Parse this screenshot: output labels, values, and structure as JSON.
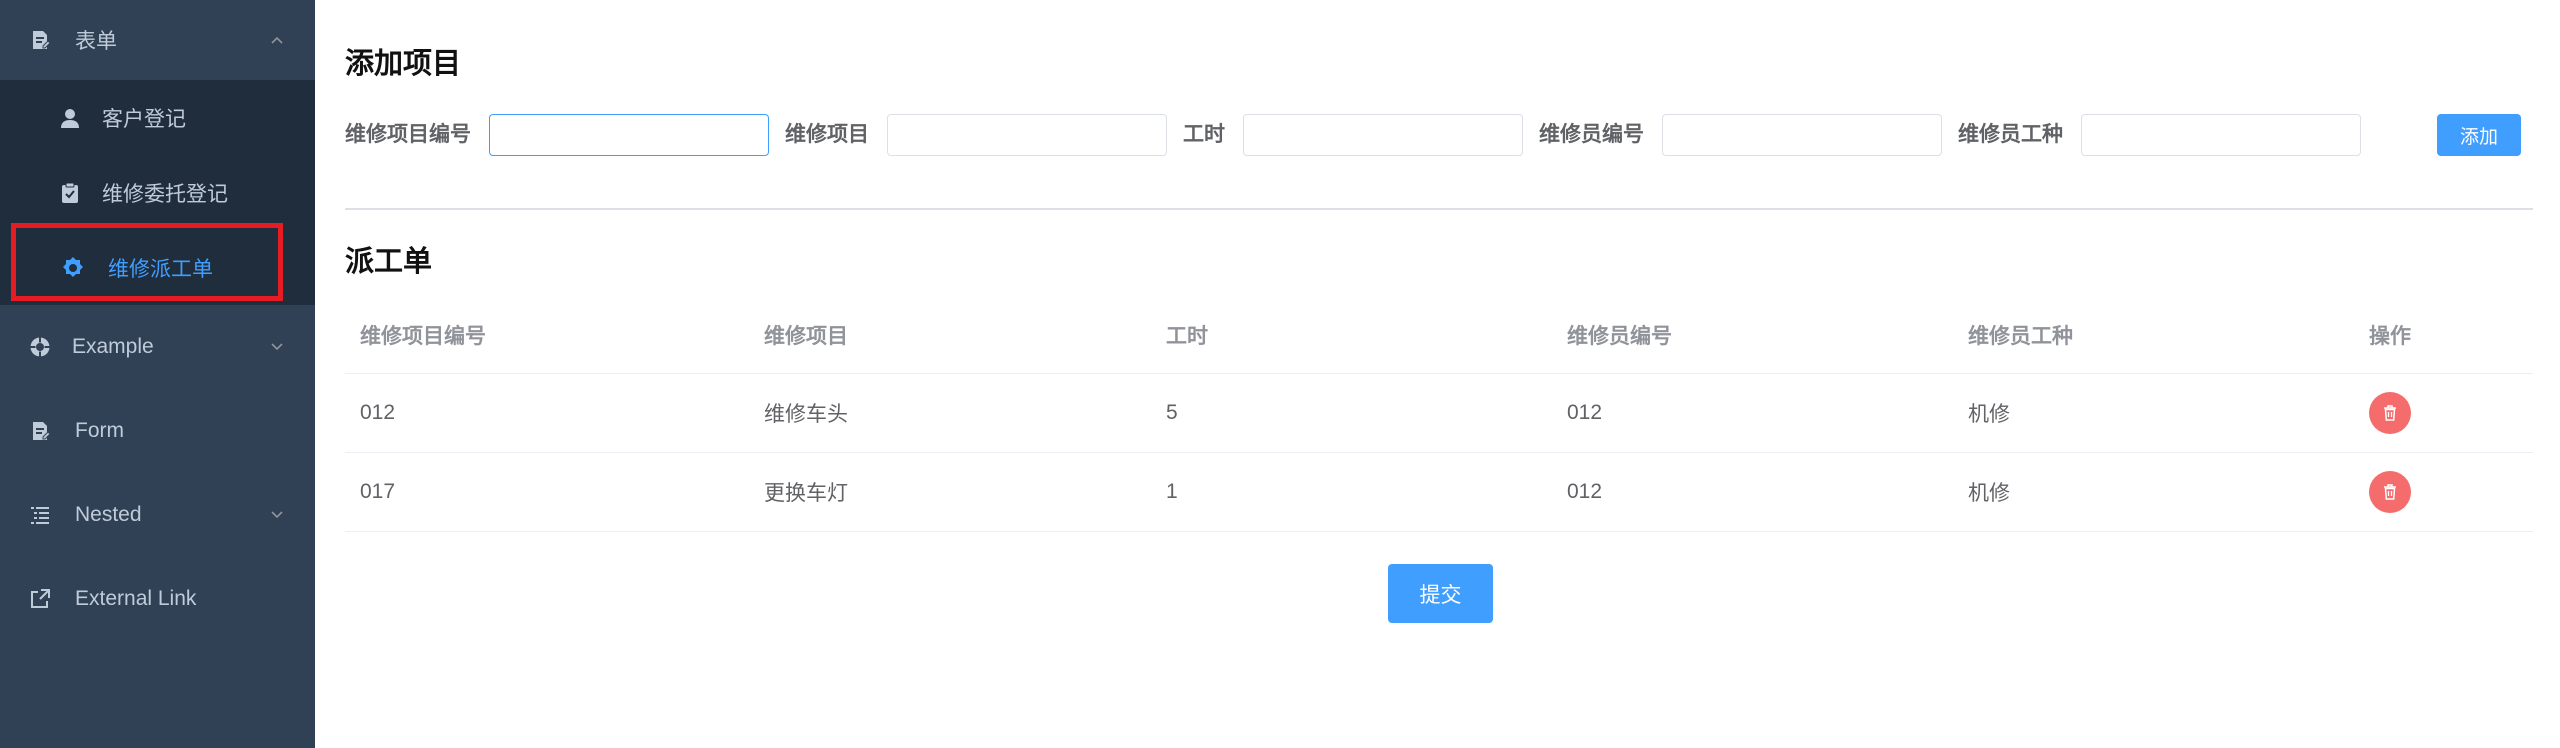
{
  "sidebar": {
    "menu_form": {
      "label": "表单",
      "icon": "document-edit-icon"
    },
    "submenu": [
      {
        "label": "客户登记",
        "icon": "user-icon"
      },
      {
        "label": "维修委托登记",
        "icon": "clipboard-check-icon"
      },
      {
        "label": "维修派工单",
        "icon": "gear-icon",
        "active": true
      }
    ],
    "items": [
      {
        "label": "Example",
        "icon": "life-ring-icon"
      },
      {
        "label": "Form",
        "icon": "document-edit-icon"
      },
      {
        "label": "Nested",
        "icon": "list-tree-icon"
      },
      {
        "label": "External Link",
        "icon": "external-link-icon"
      }
    ]
  },
  "add_section": {
    "title": "添加项目",
    "fields": [
      {
        "label": "维修项目编号",
        "value": ""
      },
      {
        "label": "维修项目",
        "value": ""
      },
      {
        "label": "工时",
        "value": ""
      },
      {
        "label": "维修员编号",
        "value": ""
      },
      {
        "label": "维修员工种",
        "value": ""
      }
    ],
    "add_button": "添加"
  },
  "dispatch": {
    "title": "派工单",
    "columns": [
      "维修项目编号",
      "维修项目",
      "工时",
      "维修员编号",
      "维修员工种",
      "操作"
    ],
    "rows": [
      [
        "012",
        "维修车头",
        "5",
        "012",
        "机修"
      ],
      [
        "017",
        "更换车灯",
        "1",
        "012",
        "机修"
      ]
    ],
    "submit_button": "提交"
  },
  "colors": {
    "sidebar_bg": "#304156",
    "submenu_bg": "#1f2d3d",
    "accent": "#409eff",
    "danger": "#f56c6c",
    "highlight": "#e51c23"
  }
}
